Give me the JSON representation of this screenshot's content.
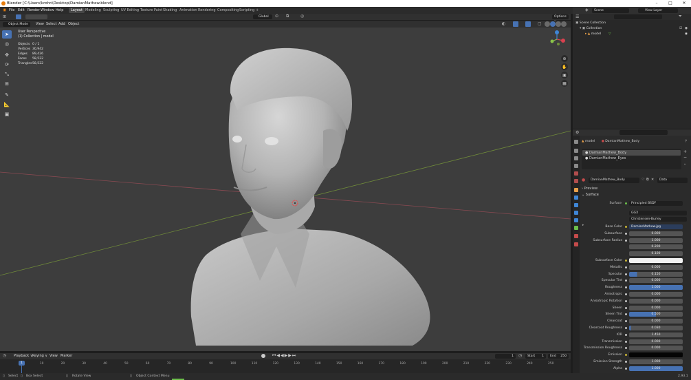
{
  "window": {
    "title": "Blender [C:\\Users\\krohn\\Desktop\\DamianMathew.blend]",
    "minimize": "–",
    "maximize": "□",
    "close": "✕"
  },
  "menus": [
    "File",
    "Edit",
    "Render",
    "Window",
    "Help"
  ],
  "workspaces": [
    "Layout",
    "Modeling",
    "Sculpting",
    "UV Editing",
    "Texture Paint",
    "Shading",
    "Animation",
    "Rendering",
    "Compositing",
    "Scripting",
    "+"
  ],
  "active_workspace": "Layout",
  "scene": {
    "label": "Scene",
    "view_layer": "View Layer"
  },
  "viewport": {
    "mode": "Object Mode",
    "menus": [
      "View",
      "Select",
      "Add",
      "Object"
    ],
    "transform_orientation": "Global",
    "options": "Options ∨",
    "perspective": "User Perspective",
    "collection_info": "(1) Collection | model",
    "stats": [
      {
        "label": "Objects",
        "value": "0 / 1"
      },
      {
        "label": "Vertices",
        "value": "30,942"
      },
      {
        "label": "Edges",
        "value": "89,426"
      },
      {
        "label": "Faces",
        "value": "58,522"
      },
      {
        "label": "Triangles",
        "value": "58,522"
      }
    ],
    "gizmo_axes": {
      "x": "X",
      "y": "Y",
      "z": "Z"
    }
  },
  "outliner": {
    "rows": [
      {
        "label": "Scene Collection",
        "indent": 0
      },
      {
        "label": "Collection",
        "indent": 1
      },
      {
        "label": "model",
        "indent": 2
      }
    ]
  },
  "properties": {
    "object_name": "model",
    "material_name": "DamianMathew_Body",
    "slots": [
      "DamianMathew_Body",
      "DamianMathew_Eyes"
    ],
    "data_label": "Data",
    "sections": {
      "preview": "Preview",
      "surface": "Surface"
    },
    "surface_shader": "Principled BSDF",
    "distribution": "GGX",
    "subsurface_method": "Christensen-Burley",
    "rows": [
      {
        "label": "Base Color",
        "value": "DamianMathew.jpg",
        "kind": "texture"
      },
      {
        "label": "Subsurface",
        "value": "0.000"
      },
      {
        "label": "Subsurface Radius",
        "value": "1.000"
      },
      {
        "label": "",
        "value": "0.200"
      },
      {
        "label": "",
        "value": "0.100"
      },
      {
        "label": "Subsurface Color",
        "value": "",
        "kind": "color-white"
      },
      {
        "label": "Metallic",
        "value": "0.000"
      },
      {
        "label": "Specular",
        "value": "0.150",
        "fill": 0.15
      },
      {
        "label": "Specular Tint",
        "value": "0.000"
      },
      {
        "label": "Roughness",
        "value": "1.000",
        "fill": 1.0
      },
      {
        "label": "Anisotropic",
        "value": "0.000"
      },
      {
        "label": "Anisotropic Rotation",
        "value": "0.000"
      },
      {
        "label": "Sheen",
        "value": "0.000"
      },
      {
        "label": "Sheen Tint",
        "value": "0.500",
        "fill": 0.5
      },
      {
        "label": "Clearcoat",
        "value": "0.000"
      },
      {
        "label": "Clearcoat Roughness",
        "value": "0.030",
        "fill": 0.03
      },
      {
        "label": "IOR",
        "value": "1.450"
      },
      {
        "label": "Transmission",
        "value": "0.000"
      },
      {
        "label": "Transmission Roughness",
        "value": "0.000"
      },
      {
        "label": "Emission",
        "value": "",
        "kind": "color-black"
      },
      {
        "label": "Emission Strength",
        "value": "1.000"
      },
      {
        "label": "Alpha",
        "value": "1.000",
        "fill": 1.0
      }
    ]
  },
  "timeline": {
    "menus": [
      "Playback ∨",
      "Keying ∨",
      "View",
      "Marker"
    ],
    "current_frame": "1",
    "start_label": "Start",
    "start": "1",
    "end_label": "End",
    "end": "250",
    "ticks": [
      "0",
      "10",
      "20",
      "30",
      "40",
      "50",
      "60",
      "70",
      "80",
      "90",
      "100",
      "110",
      "120",
      "130",
      "140",
      "150",
      "160",
      "170",
      "180",
      "190",
      "200",
      "210",
      "220",
      "230",
      "240",
      "250"
    ]
  },
  "statusbar": {
    "select": "Select",
    "box_select": "Box Select",
    "rotate_view": "Rotate View",
    "context_menu": "Object Context Menu",
    "version": "2.93.1"
  },
  "colors": {
    "accent": "#4772b3",
    "brand": "#e87d0d",
    "x_axis": "#d9414f",
    "y_axis": "#8bc34a",
    "z_axis": "#3f86d6"
  }
}
